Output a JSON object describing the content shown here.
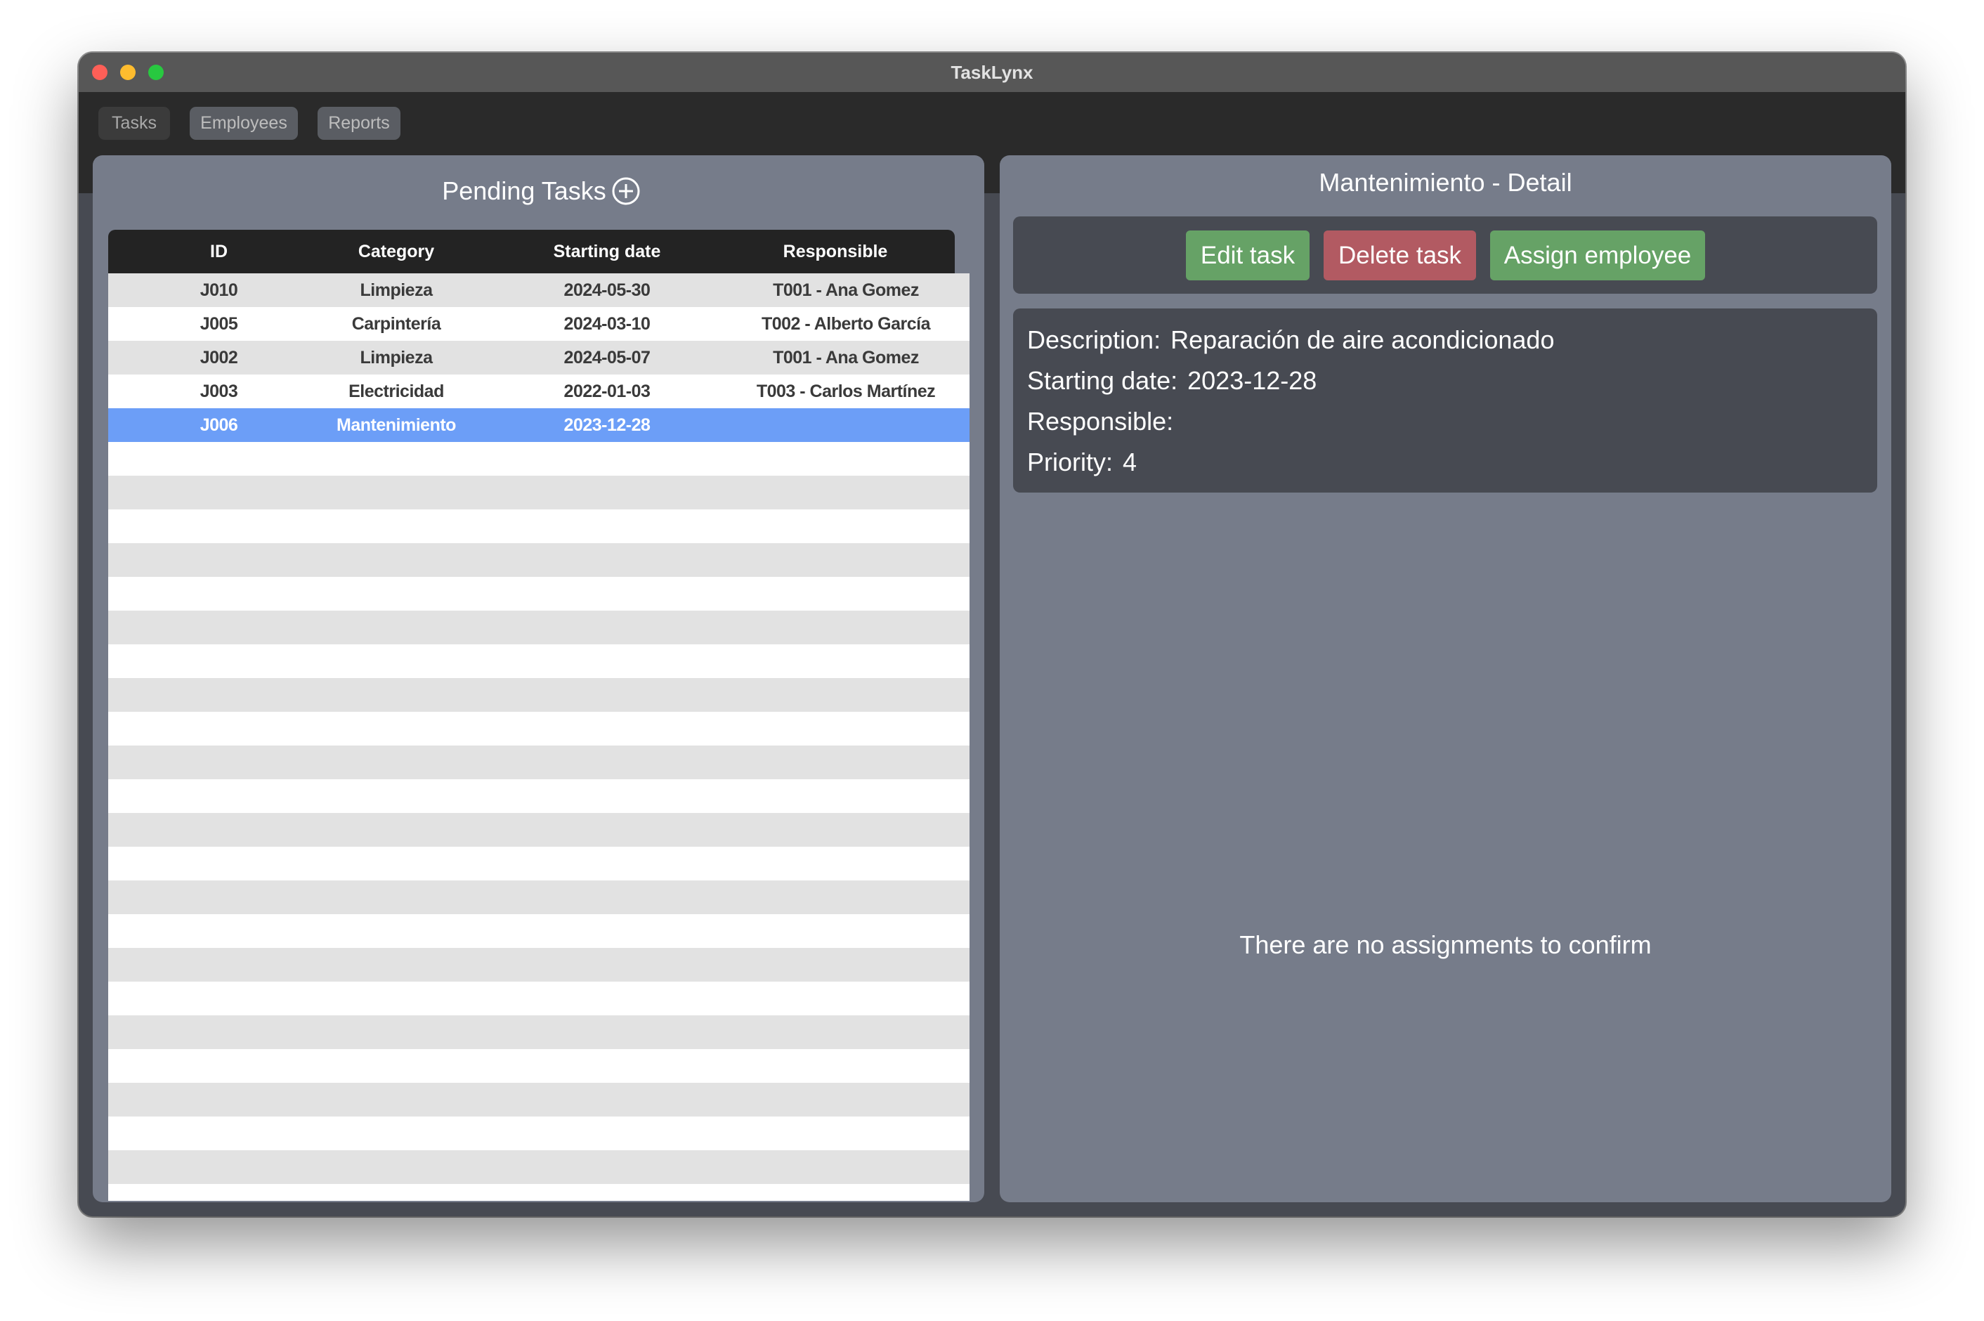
{
  "window": {
    "title": "TaskLynx"
  },
  "nav": {
    "tabs": [
      {
        "label": "Tasks",
        "active": true
      },
      {
        "label": "Employees",
        "active": false
      },
      {
        "label": "Reports",
        "active": false
      }
    ]
  },
  "tasks_panel": {
    "title": "Pending Tasks",
    "add_icon": "plus-circle-icon",
    "columns": [
      "ID",
      "Category",
      "Starting date",
      "Responsible"
    ],
    "rows": [
      {
        "id": "J010",
        "category": "Limpieza",
        "starting_date": "2024-05-30",
        "responsible": "T001 - Ana Gomez",
        "selected": false
      },
      {
        "id": "J005",
        "category": "Carpintería",
        "starting_date": "2024-03-10",
        "responsible": "T002 - Alberto García",
        "selected": false
      },
      {
        "id": "J002",
        "category": "Limpieza",
        "starting_date": "2024-05-07",
        "responsible": "T001 - Ana Gomez",
        "selected": false
      },
      {
        "id": "J003",
        "category": "Electricidad",
        "starting_date": "2022-01-03",
        "responsible": "T003 - Carlos Martínez",
        "selected": false
      },
      {
        "id": "J006",
        "category": "Mantenimiento",
        "starting_date": "2023-12-28",
        "responsible": "",
        "selected": true
      }
    ]
  },
  "detail_panel": {
    "title": "Mantenimiento - Detail",
    "buttons": {
      "edit": "Edit task",
      "delete": "Delete task",
      "assign": "Assign employee"
    },
    "fields": {
      "description_label": "Description:",
      "description_value": "Reparación de aire acondicionado",
      "starting_date_label": "Starting date:",
      "starting_date_value": "2023-12-28",
      "responsible_label": "Responsible:",
      "responsible_value": "",
      "priority_label": "Priority:",
      "priority_value": "4"
    }
  },
  "assignments_panel": {
    "empty_message": "There are no assignments to confirm"
  },
  "colors": {
    "panel_bg": "#767c8a",
    "header_bg": "#232323",
    "selected_row": "#6c9ef7",
    "button_green": "#66a266",
    "button_red": "#b25a62"
  }
}
